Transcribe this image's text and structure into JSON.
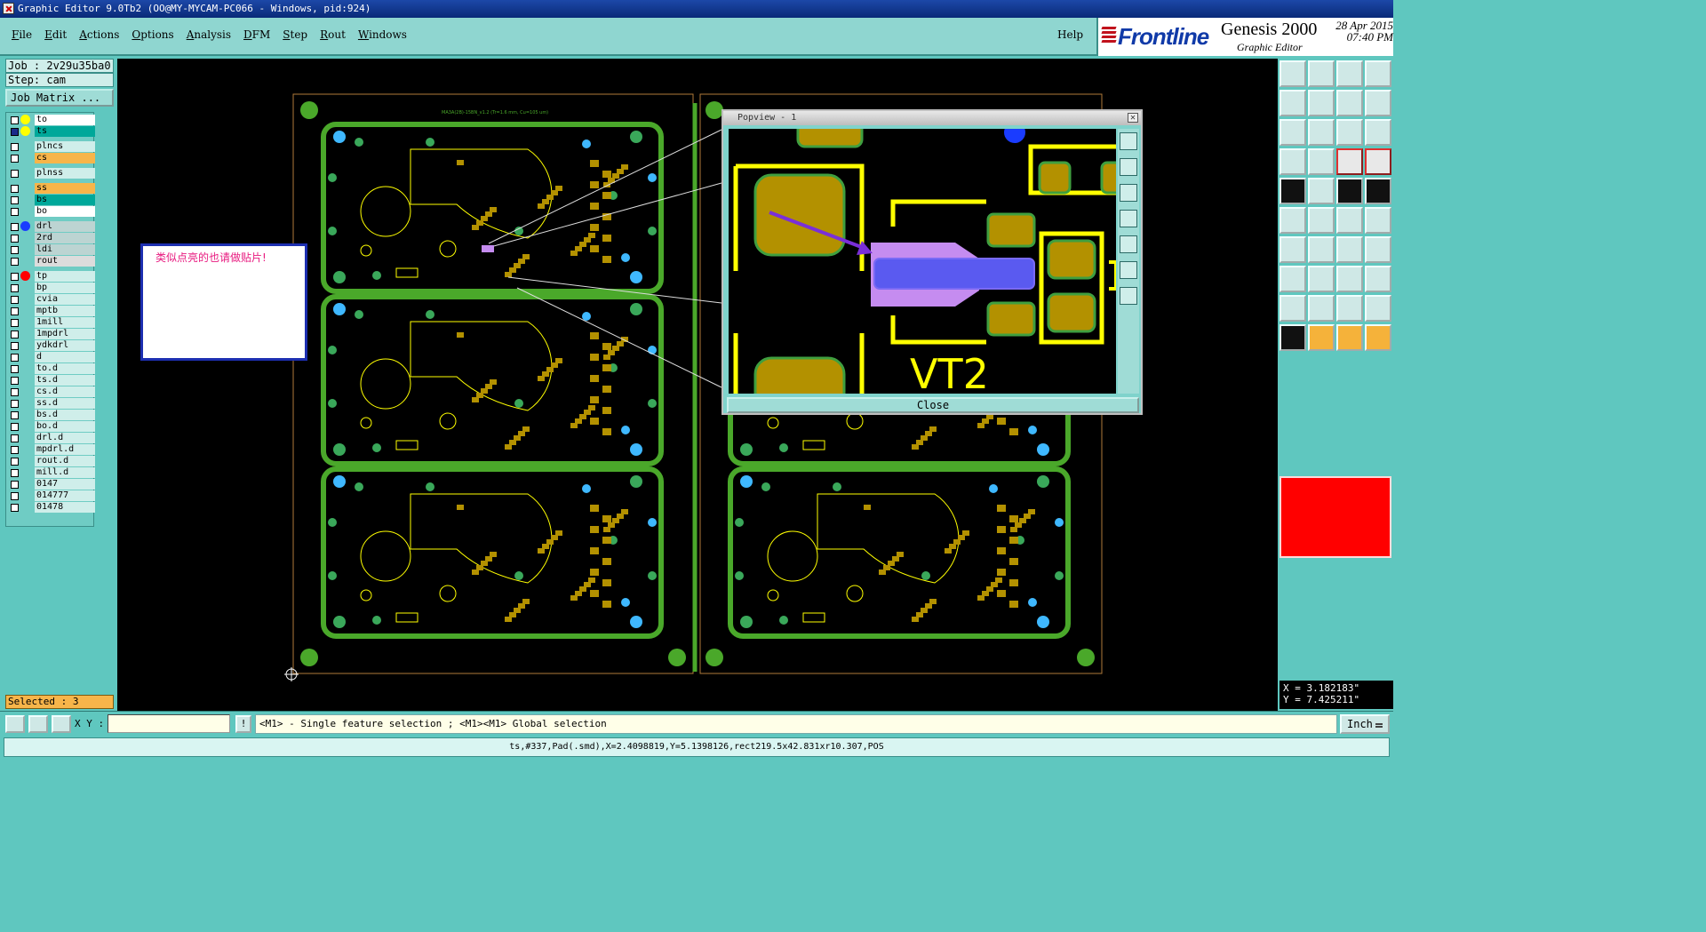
{
  "window": {
    "title": "Graphic Editor 9.0Tb2 (OO@MY-MYCAM-PC066 - Windows, pid:924)"
  },
  "menu": {
    "items": [
      "File",
      "Edit",
      "Actions",
      "Options",
      "Analysis",
      "DFM",
      "Step",
      "Rout",
      "Windows"
    ],
    "help": "Help"
  },
  "brand": {
    "logo_text": "Frontline",
    "product": "Genesis 2000",
    "subtitle": "Graphic Editor",
    "date": "28 Apr 2015",
    "time": "07:40 PM"
  },
  "job": {
    "job_label": "Job : 2v29u35ba0",
    "step_label": "Step: cam",
    "matrix_button": "Job Matrix ..."
  },
  "layers": [
    {
      "name": "to",
      "dot": "#ffff00",
      "fill": "#ffffff"
    },
    {
      "name": "ts",
      "dot": "#ffff00",
      "fill": "#00a89a",
      "active": true
    },
    {
      "name": "plncs",
      "dot": "",
      "fill": "#cfeeea"
    },
    {
      "name": "cs",
      "dot": "",
      "fill": "#f7b54a"
    },
    {
      "name": "plnss",
      "dot": "",
      "fill": "#cfeeea"
    },
    {
      "name": "ss",
      "dot": "",
      "fill": "#f7b54a"
    },
    {
      "name": "bs",
      "dot": "",
      "fill": "#00a89a"
    },
    {
      "name": "bo",
      "dot": "",
      "fill": "#ffffff"
    },
    {
      "name": "drl",
      "dot": "#1a3cff",
      "fill": "#bcd4d2"
    },
    {
      "name": "2rd",
      "dot": "",
      "fill": "#bcd4d2"
    },
    {
      "name": "ldi",
      "dot": "",
      "fill": "#bcd4d2"
    },
    {
      "name": "rout",
      "dot": "",
      "fill": "#dcdcdc"
    },
    {
      "name": "tp",
      "dot": "#ff0000",
      "fill": "#cfeeea"
    },
    {
      "name": "bp",
      "dot": "",
      "fill": "#cfeeea"
    },
    {
      "name": "cvia",
      "dot": "",
      "fill": "#cfeeea"
    },
    {
      "name": "mptb",
      "dot": "",
      "fill": "#cfeeea"
    },
    {
      "name": "1mill",
      "dot": "",
      "fill": "#cfeeea"
    },
    {
      "name": "1mpdrl",
      "dot": "",
      "fill": "#cfeeea"
    },
    {
      "name": "ydkdrl",
      "dot": "",
      "fill": "#cfeeea"
    },
    {
      "name": "d",
      "dot": "",
      "fill": "#cfeeea"
    },
    {
      "name": "to.d",
      "dot": "",
      "fill": "#cfeeea"
    },
    {
      "name": "ts.d",
      "dot": "",
      "fill": "#cfeeea"
    },
    {
      "name": "cs.d",
      "dot": "",
      "fill": "#cfeeea"
    },
    {
      "name": "ss.d",
      "dot": "",
      "fill": "#cfeeea"
    },
    {
      "name": "bs.d",
      "dot": "",
      "fill": "#cfeeea"
    },
    {
      "name": "bo.d",
      "dot": "",
      "fill": "#cfeeea"
    },
    {
      "name": "drl.d",
      "dot": "",
      "fill": "#cfeeea"
    },
    {
      "name": "mpdrl.d",
      "dot": "",
      "fill": "#cfeeea"
    },
    {
      "name": "rout.d",
      "dot": "",
      "fill": "#cfeeea"
    },
    {
      "name": "mill.d",
      "dot": "",
      "fill": "#cfeeea"
    },
    {
      "name": "0147",
      "dot": "",
      "fill": "#cfeeea"
    },
    {
      "name": "014777",
      "dot": "",
      "fill": "#cfeeea"
    },
    {
      "name": "01478",
      "dot": "",
      "fill": "#cfeeea"
    }
  ],
  "selected": "Selected : 3",
  "annotation": "类似点亮的也请做贴片!",
  "popview": {
    "title": "Popview - 1",
    "label": "VT2",
    "close_button": "Close"
  },
  "board": {
    "label": "MA3A(2B)-15BN_v1.2",
    "top_label": "MA3A(2B)-15BN_v1.2 (Tr=1.6 mm, Cu=105 um)"
  },
  "coords": {
    "x": "X = 3.182183\"",
    "y": "Y = 7.425211\""
  },
  "command": {
    "xy_label": "X Y :",
    "xy_value": "",
    "exclaim": "!",
    "hint": "<M1> - Single feature selection ; <M1><M1> Global selection",
    "units": "Inch"
  },
  "status": "ts,#337,Pad(.smd),X=2.4098819,Y=5.1398126,rect219.5x42.831xr10.307,POS"
}
